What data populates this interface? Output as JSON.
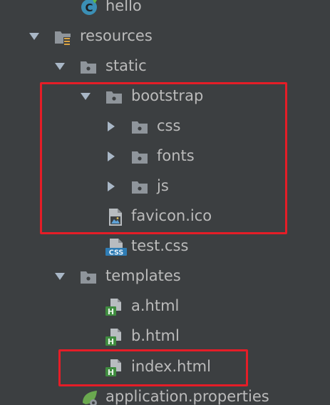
{
  "tree": {
    "hello": "hello",
    "resources": "resources",
    "static": "static",
    "bootstrap": "bootstrap",
    "css": "css",
    "fonts": "fonts",
    "js": "js",
    "favicon": "favicon.ico",
    "test_css": "test.css",
    "templates": "templates",
    "a_html": "a.html",
    "b_html": "b.html",
    "index_html": "index.html",
    "app_props": "application.properties"
  },
  "icons": {
    "class_file": "java-class-icon",
    "resource_folder": "resources-folder-icon",
    "folder": "folder-icon",
    "image_file": "image-file-icon",
    "css_file": "css-file-icon",
    "html_file": "html-file-icon",
    "properties_file": "spring-properties-icon"
  },
  "colors": {
    "background": "#3c3f41",
    "text": "#bbbbbb",
    "highlight_border": "#e51d27",
    "folder_icon": "#8f959b",
    "html_badge": "#3f8c3f",
    "css_badge": "#2f7db5"
  }
}
